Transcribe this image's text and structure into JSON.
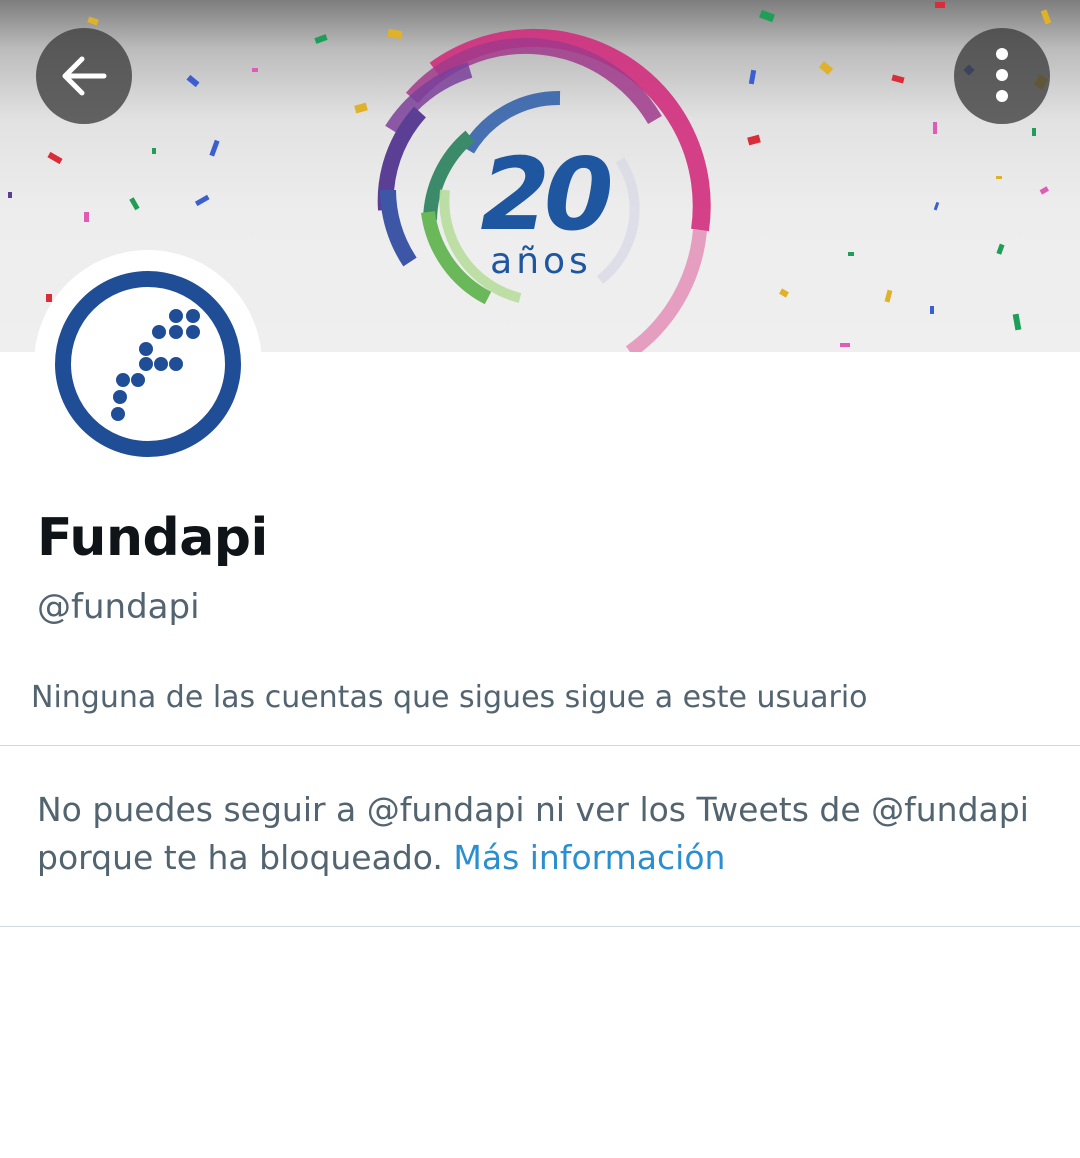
{
  "header": {
    "back_icon": "arrow-left-icon",
    "more_icon": "more-vertical-icon"
  },
  "banner": {
    "number": "20",
    "label": "años",
    "colors": {
      "magenta": "#d12e7c",
      "purple": "#5b3f95",
      "blue": "#2b5ca7",
      "green": "#6bb85a"
    }
  },
  "profile": {
    "display_name": "Fundapi",
    "handle": "@fundapi",
    "followers_note": "Ninguna de las cuentas que sigues sigue a este usuario"
  },
  "blocked": {
    "message": "No puedes seguir a @fundapi ni ver los Tweets de @fundapi porque te ha bloqueado.",
    "link_label": "Más información"
  },
  "colors": {
    "link": "#1d9bf0",
    "secondary_text": "#536471",
    "primary_text": "#0f1419",
    "avatar_blue": "#1f4e96"
  }
}
